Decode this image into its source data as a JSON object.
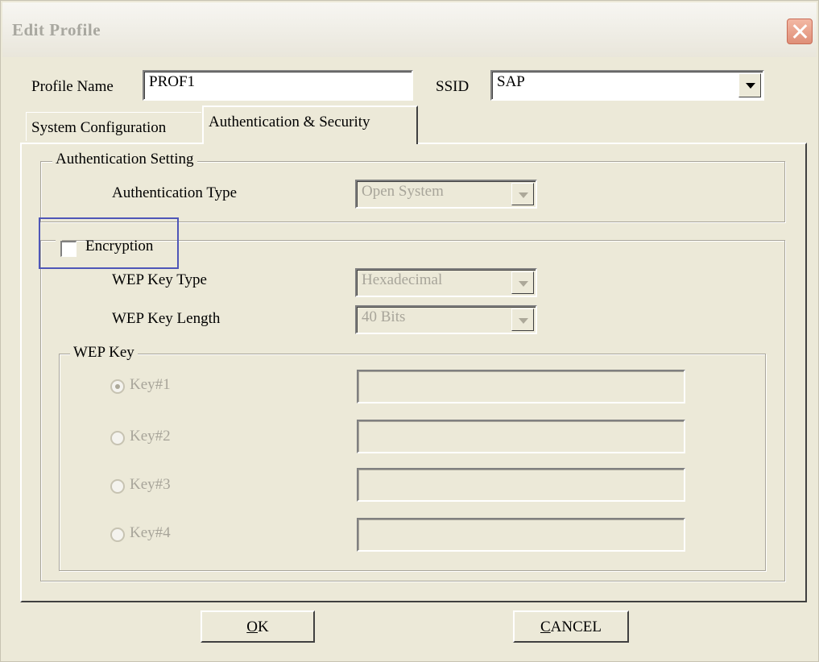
{
  "window": {
    "title": "Edit Profile",
    "close_icon": "close-icon"
  },
  "profile": {
    "name_label": "Profile Name",
    "name_value": "PROF1",
    "ssid_label": "SSID",
    "ssid_value": "SAP"
  },
  "tabs": [
    {
      "label": "System Configuration",
      "active": false
    },
    {
      "label": "Authentication & Security",
      "active": true
    }
  ],
  "authentication": {
    "group_title": "Authentication Setting",
    "type_label": "Authentication Type",
    "type_value": "Open System"
  },
  "encryption": {
    "label": "Encryption",
    "checked": false,
    "wep_key_type_label": "WEP Key Type",
    "wep_key_type_value": "Hexadecimal",
    "wep_key_length_label": "WEP Key Length",
    "wep_key_length_value": "40 Bits"
  },
  "wep_key": {
    "group_title": "WEP Key",
    "keys": [
      {
        "label": "Key#1",
        "selected": true,
        "value": ""
      },
      {
        "label": "Key#2",
        "selected": false,
        "value": ""
      },
      {
        "label": "Key#3",
        "selected": false,
        "value": ""
      },
      {
        "label": "Key#4",
        "selected": false,
        "value": ""
      }
    ]
  },
  "buttons": {
    "ok_mnemonic": "O",
    "ok_rest": "K",
    "cancel_mnemonic": "C",
    "cancel_rest": "ANCEL"
  },
  "colors": {
    "dialog_background": "#ece9d8",
    "focus_rect": "#4e56b8",
    "disabled_text": "#a8a59a",
    "close_button": "#df8f78"
  }
}
